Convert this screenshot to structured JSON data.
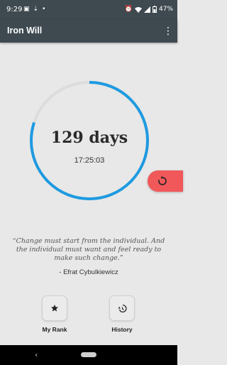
{
  "status_bar": {
    "time": "9:29",
    "notification_icons": [
      "message-icon",
      "download-icon",
      "dot-icon"
    ],
    "battery": "47%"
  },
  "app_bar": {
    "title": "Iron Will",
    "menu_icon": "more-vert-icon"
  },
  "streak": {
    "days": "129 days",
    "clock": "17:25:03",
    "progress_fraction": 0.8
  },
  "colors": {
    "ring_progress": "#1e9ae0",
    "ring_track": "#dcdcdc",
    "fab": "#f0585a",
    "bar": "#3f4a50"
  },
  "reset": {
    "icon": "restart-icon"
  },
  "quote": {
    "text": "“Change must start from the individual. And the individual must want and feel ready to make such change.”",
    "author": "- Efrat Cybulkiewicz"
  },
  "actions": {
    "my_rank": {
      "label": "My Rank",
      "icon": "star-icon"
    },
    "history": {
      "label": "History",
      "icon": "history-icon"
    }
  },
  "nav": {
    "back_icon": "back-icon"
  }
}
